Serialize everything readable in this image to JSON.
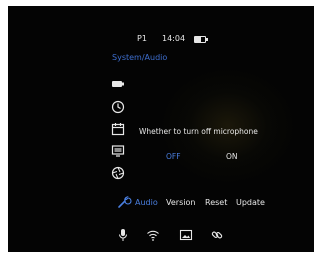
{
  "status_bar": {
    "page": "P1",
    "time": "14:04",
    "battery_icon": "battery-icon"
  },
  "breadcrumb": "System/Audio",
  "side_icons": [
    "record-icon",
    "clock-icon",
    "calendar-icon",
    "screen-icon",
    "shutter-icon"
  ],
  "setting": {
    "label": "Whether to turn off microphone",
    "options": [
      "OFF",
      "ON"
    ],
    "selected": "OFF"
  },
  "tabs": {
    "icon": "wrench-icon",
    "items": [
      "Audio",
      "Version",
      "Reset",
      "Update"
    ],
    "active": "Audio"
  },
  "bottom_icons": [
    "microphone-icon",
    "wifi-icon",
    "image-icon",
    "link-icon"
  ],
  "colors": {
    "accent": "#4a7fe0",
    "breadcrumb": "#3e6fd0",
    "text": "#e8e8e8",
    "background": "#040404"
  }
}
